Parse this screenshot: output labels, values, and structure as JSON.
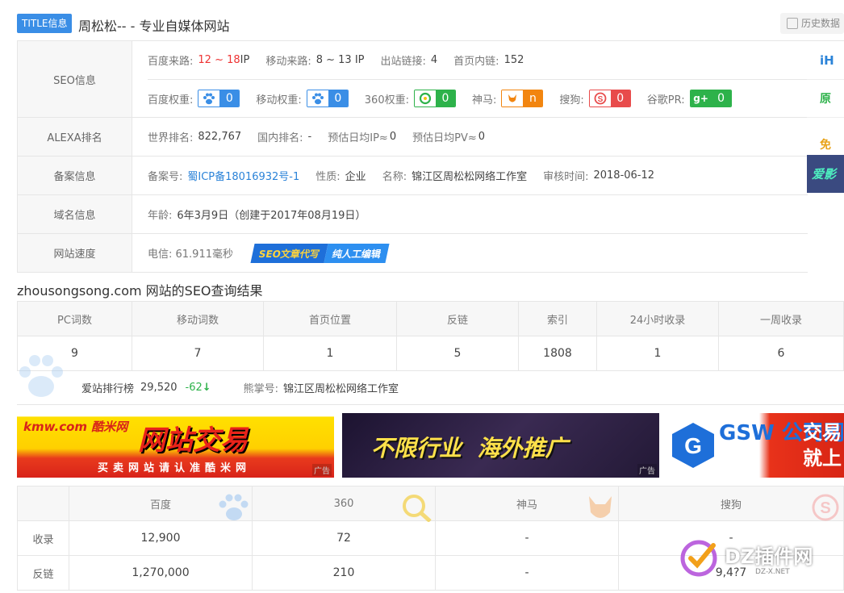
{
  "header": {
    "title_tag": "TITLE信息",
    "site_title": "周松松-- - 专业自媒体网站",
    "history_label": "历史数据"
  },
  "seo": {
    "label": "SEO信息",
    "traffic": [
      {
        "k": "百度来路:",
        "v": "12 ~ 18",
        "unit": " IP"
      },
      {
        "k": "移动来路:",
        "v": "8 ~ 13 IP"
      },
      {
        "k": "出站链接:",
        "v": "4"
      },
      {
        "k": "首页内链:",
        "v": "152"
      }
    ],
    "weights": [
      {
        "k": "百度权重:",
        "v": "0",
        "icon": "baidu-paw-icon"
      },
      {
        "k": "移动权重:",
        "v": "0",
        "icon": "baidu-mobile-paw-icon"
      },
      {
        "k": "360权重:",
        "v": "0",
        "icon": "360-icon"
      },
      {
        "k": "神马:",
        "v": "n",
        "icon": "shenma-icon"
      },
      {
        "k": "搜狗:",
        "v": "0",
        "icon": "sogou-icon"
      },
      {
        "k": "谷歌PR:",
        "v": "0",
        "icon": "google-plus-icon"
      }
    ]
  },
  "alexa": {
    "label": "ALEXA排名",
    "items": [
      {
        "k": "世界排名:",
        "v": "822,767"
      },
      {
        "k": "国内排名:",
        "v": "-"
      },
      {
        "k": "预估日均IP≈",
        "v": "0"
      },
      {
        "k": "预估日均PV≈",
        "v": "0"
      }
    ]
  },
  "icp": {
    "label": "备案信息",
    "items": [
      {
        "k": "备案号:",
        "v": "蜀ICP备18016932号-1"
      },
      {
        "k": "性质:",
        "v": "企业"
      },
      {
        "k": "名称:",
        "v": "锦江区周松松网络工作室"
      },
      {
        "k": "审核时间:",
        "v": "2018-06-12"
      }
    ]
  },
  "domain": {
    "label": "域名信息",
    "age_k": "年龄:",
    "age_v": "6年3月9日（创建于2017年08月19日）"
  },
  "speed": {
    "label": "网站速度",
    "text": "电信: 61.911毫秒",
    "promo_1": "SEO文章代写",
    "promo_2": "纯人工编辑"
  },
  "side_ad": [
    "iH",
    "原",
    "免",
    "爱影"
  ],
  "result_heading": "zhousongsong.com 网站的SEO查询结果",
  "stats": {
    "headers": [
      "PC词数",
      "移动词数",
      "首页位置",
      "反链",
      "索引",
      "24小时收录",
      "一周收录"
    ],
    "values": [
      "9",
      "7",
      "1",
      "5",
      "1808",
      "1",
      "6"
    ]
  },
  "rank": {
    "label": "爱站排行榜",
    "value": "29,520",
    "change": "-62",
    "xiongzhang_label": "熊掌号:",
    "xiongzhang_value": "锦江区周松松网络工作室"
  },
  "ads": [
    {
      "brand": "kmw.com 酷米网",
      "headline": "网站交易",
      "sub": "买卖网站请认准酷米网",
      "tag": "广告"
    },
    {
      "headline": "不限行业  海外推广",
      "tag": "广告"
    },
    {
      "brand": "GSW 公司网",
      "headline": "交易 就上"
    }
  ],
  "engines": {
    "headers": [
      "",
      "百度",
      "360",
      "神马",
      "搜狗"
    ],
    "rows": [
      {
        "label": "收录",
        "values": [
          "12,900",
          "72",
          "-",
          "-"
        ]
      },
      {
        "label": "反链",
        "values": [
          "1,270,000",
          "210",
          "-",
          "9,4?7"
        ]
      }
    ]
  },
  "watermark": {
    "text": "DZ插件网",
    "sub": "DZ-X.NET"
  },
  "colors": {
    "accent": "#3a8ee6",
    "red": "#e33333",
    "green": "#2db24a",
    "orange": "#f2850f"
  }
}
